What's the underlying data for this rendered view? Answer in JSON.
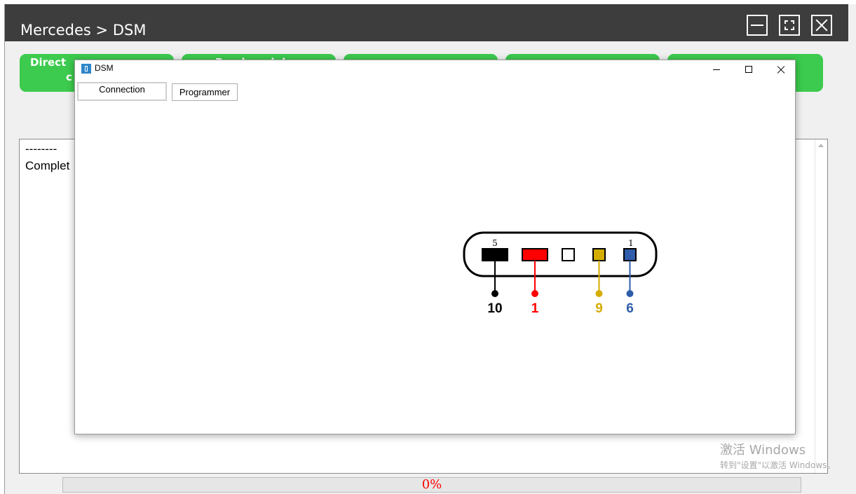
{
  "app": {
    "title": "Mercedes > DSM",
    "accent": "#3ccb4e",
    "titlebar_color": "#3d3d3d"
  },
  "green_buttons": [
    {
      "label": "Direct connection of",
      "visible_fragment": "Direct"
    },
    {
      "label": "Read module"
    },
    {
      "label": ""
    },
    {
      "label": ""
    },
    {
      "label": ""
    }
  ],
  "green_button_fragment_2": "c",
  "log": {
    "lines": [
      "--------",
      "Complet"
    ]
  },
  "progress": {
    "label": "0%",
    "value": 0
  },
  "watermark": {
    "line1": "激活 Windows",
    "line2": "转到\"设置\"以激活 Windows。"
  },
  "dsm_window": {
    "title": "DSM",
    "tabs": [
      "Connection",
      "Programmer"
    ],
    "active_tab": "Connection"
  },
  "connector": {
    "top_labels": [
      "5",
      "1"
    ],
    "pins": [
      {
        "label": "10",
        "color": "#000000"
      },
      {
        "label": "1",
        "color": "#ff0000"
      },
      {
        "label": "",
        "color": "#ffffff"
      },
      {
        "label": "9",
        "color": "#d4ad00"
      },
      {
        "label": "6",
        "color": "#2f5dab"
      }
    ]
  }
}
